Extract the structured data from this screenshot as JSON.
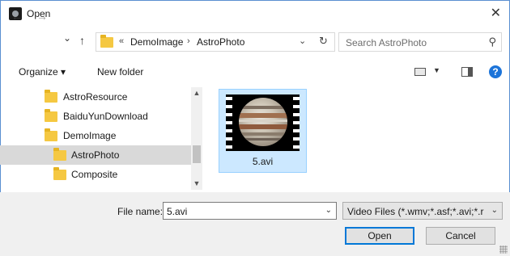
{
  "window": {
    "title": "Open",
    "close_glyph": "✕"
  },
  "nav": {
    "back_glyph": "←",
    "forward_glyph": "→",
    "recent_glyph": "⌄",
    "up_glyph": "↑",
    "overflow": "«",
    "breadcrumbs": [
      "DemoImage",
      "AstroPhoto"
    ],
    "crumb_separator": "›",
    "dropdown_glyph": "⌄",
    "refresh_glyph": "↻"
  },
  "search": {
    "placeholder": "Search AstroPhoto",
    "icon_glyph": "⚲"
  },
  "toolbar": {
    "organize_label": "Organize ▾",
    "new_folder_label": "New folder",
    "view_dropdown": "▼",
    "help_label": "?"
  },
  "tree": {
    "items": [
      {
        "label": "AstroResource",
        "indent": 1,
        "selected": false
      },
      {
        "label": "BaiduYunDownload",
        "indent": 1,
        "selected": false
      },
      {
        "label": "DemoImage",
        "indent": 1,
        "selected": false
      },
      {
        "label": "AstroPhoto",
        "indent": 2,
        "selected": true
      },
      {
        "label": "Composite",
        "indent": 2,
        "selected": false
      }
    ],
    "scroll_up": "▲",
    "scroll_down": "▼"
  },
  "files": [
    {
      "name": "5.avi",
      "icon": "video-thumbnail-icon",
      "selected": true
    }
  ],
  "footer": {
    "file_name_label": "File name:",
    "file_name_value": "5.avi",
    "file_name_dropdown": "⌄",
    "file_type": "Video Files (*.wmv;*.asf;*.avi;*.r",
    "file_type_dropdown": "⌄",
    "open_label": "Open",
    "cancel_label": "Cancel"
  },
  "colors": {
    "accent": "#0078d7",
    "selection": "#cce8ff",
    "folder": "#f5c842"
  }
}
